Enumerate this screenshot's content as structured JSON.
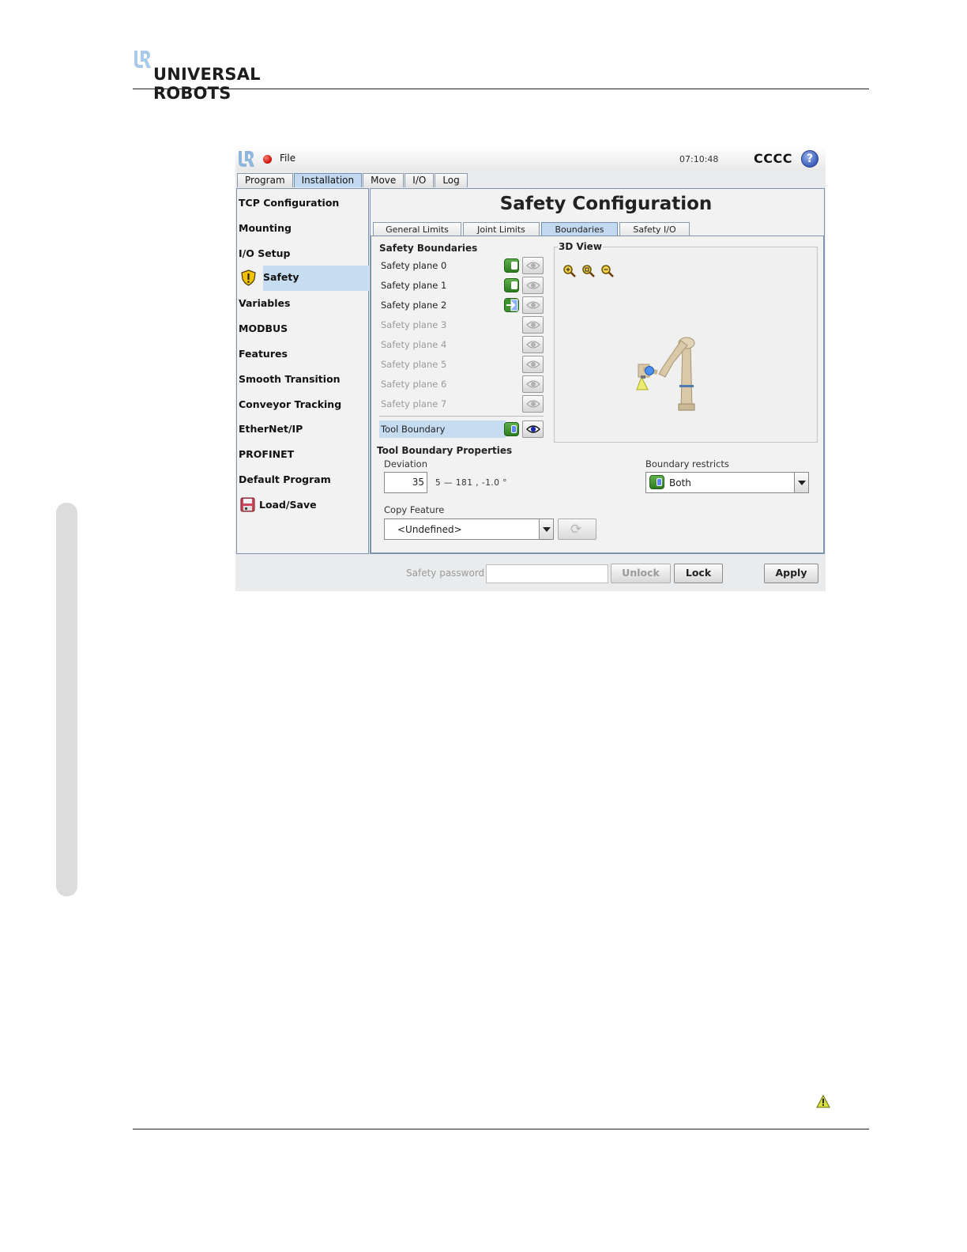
{
  "brand": {
    "name": "UNIVERSAL ROBOTS"
  },
  "titlebar": {
    "menu_label": "File",
    "time": "07:10:48",
    "robot_name": "CCCC",
    "help_label": "?"
  },
  "main_tabs": [
    {
      "label": "Program",
      "active": false
    },
    {
      "label": "Installation",
      "active": true
    },
    {
      "label": "Move",
      "active": false
    },
    {
      "label": "I/O",
      "active": false
    },
    {
      "label": "Log",
      "active": false
    }
  ],
  "sidebar": {
    "items": [
      {
        "label": "TCP Configuration"
      },
      {
        "label": "Mounting"
      },
      {
        "label": "I/O Setup"
      },
      {
        "label": "Safety",
        "selected": true,
        "icon": "warning-shield-icon"
      },
      {
        "label": "Variables"
      },
      {
        "label": "MODBUS"
      },
      {
        "label": "Features"
      },
      {
        "label": "Smooth Transition"
      },
      {
        "label": "Conveyor Tracking"
      },
      {
        "label": "EtherNet/IP"
      },
      {
        "label": "PROFINET"
      },
      {
        "label": "Default Program"
      },
      {
        "label": "Load/Save",
        "icon": "floppy-disk-icon"
      }
    ]
  },
  "main": {
    "title": "Safety Configuration",
    "sub_tabs": [
      {
        "label": "General Limits",
        "active": false
      },
      {
        "label": "Joint Limits",
        "active": false
      },
      {
        "label": "Boundaries",
        "active": true
      },
      {
        "label": "Safety I/O",
        "active": false
      }
    ],
    "boundaries": {
      "heading": "Safety Boundaries",
      "planes": [
        {
          "label": "Safety plane 0",
          "enabled": true,
          "mode": "toggle"
        },
        {
          "label": "Safety plane 1",
          "enabled": true,
          "mode": "toggle"
        },
        {
          "label": "Safety plane 2",
          "enabled": true,
          "mode": "trigger"
        },
        {
          "label": "Safety plane 3",
          "enabled": false
        },
        {
          "label": "Safety plane 4",
          "enabled": false
        },
        {
          "label": "Safety plane 5",
          "enabled": false
        },
        {
          "label": "Safety plane 6",
          "enabled": false
        },
        {
          "label": "Safety plane 7",
          "enabled": false
        }
      ],
      "tool_boundary": {
        "label": "Tool Boundary",
        "enabled": true,
        "visible": true
      }
    },
    "view3d": {
      "label": "3D View",
      "zoom_icons": [
        "zoom-in-icon",
        "zoom-reset-icon",
        "zoom-out-icon"
      ]
    },
    "tool_props": {
      "heading": "Tool Boundary Properties",
      "deviation_label": "Deviation",
      "deviation_value": "35",
      "deviation_range": "5 — 181 , -1.0 °",
      "restricts_label": "Boundary restricts",
      "restricts_value": "Both",
      "copy_label": "Copy Feature",
      "copy_value": "<Undefined>"
    }
  },
  "bottom_bar": {
    "password_label": "Safety password",
    "password_value": "",
    "unlock_label": "Unlock",
    "lock_label": "Lock",
    "apply_label": "Apply"
  },
  "colors": {
    "accent_blue": "#c3d9ef",
    "toggle_green": "#3f9130",
    "alert_red": "#c30d00"
  }
}
